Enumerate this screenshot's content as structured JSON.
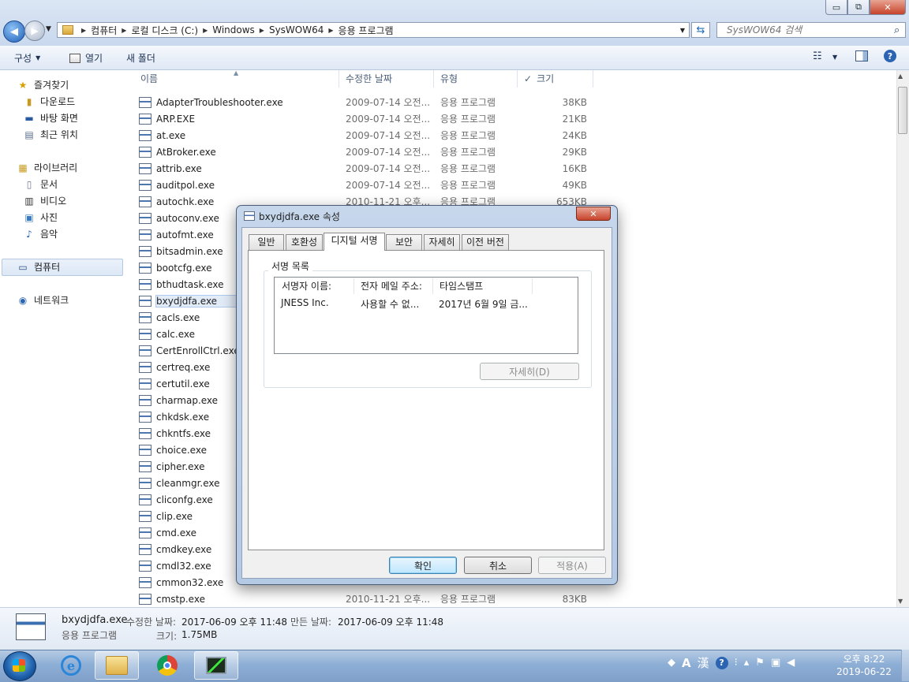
{
  "window": {
    "minimize": "▭",
    "maximize": "⧉",
    "close": "✕"
  },
  "address": {
    "crumbs": [
      "컴퓨터",
      "로컬 디스크 (C:)",
      "Windows",
      "SysWOW64",
      "응용 프로그램"
    ]
  },
  "search": {
    "placeholder": "SysWOW64 검색"
  },
  "toolbar": {
    "organize": "구성",
    "open": "열기",
    "new_folder": "새 폴더"
  },
  "navpane": {
    "favorites": "즐겨찾기",
    "downloads": "다운로드",
    "desktop": "바탕 화면",
    "recent": "최근 위치",
    "libraries": "라이브러리",
    "documents": "문서",
    "videos": "비디오",
    "pictures": "사진",
    "music": "음악",
    "computer": "컴퓨터",
    "network": "네트워크"
  },
  "columns": {
    "name": "이름",
    "date": "수정한 날짜",
    "type": "유형",
    "size": "크기"
  },
  "files": [
    {
      "name": "AdapterTroubleshooter.exe",
      "date": "2009-07-14 오전...",
      "type": "응용 프로그램",
      "size": "38KB"
    },
    {
      "name": "ARP.EXE",
      "date": "2009-07-14 오전...",
      "type": "응용 프로그램",
      "size": "21KB"
    },
    {
      "name": "at.exe",
      "date": "2009-07-14 오전...",
      "type": "응용 프로그램",
      "size": "24KB"
    },
    {
      "name": "AtBroker.exe",
      "date": "2009-07-14 오전...",
      "type": "응용 프로그램",
      "size": "29KB"
    },
    {
      "name": "attrib.exe",
      "date": "2009-07-14 오전...",
      "type": "응용 프로그램",
      "size": "16KB"
    },
    {
      "name": "auditpol.exe",
      "date": "2009-07-14 오전...",
      "type": "응용 프로그램",
      "size": "49KB"
    },
    {
      "name": "autochk.exe",
      "date": "2010-11-21 오후...",
      "type": "응용 프로그램",
      "size": "653KB"
    },
    {
      "name": "autoconv.exe",
      "date": "",
      "type": "",
      "size": ""
    },
    {
      "name": "autofmt.exe",
      "date": "",
      "type": "",
      "size": ""
    },
    {
      "name": "bitsadmin.exe",
      "date": "",
      "type": "",
      "size": ""
    },
    {
      "name": "bootcfg.exe",
      "date": "",
      "type": "",
      "size": ""
    },
    {
      "name": "bthudtask.exe",
      "date": "",
      "type": "",
      "size": ""
    },
    {
      "name": "bxydjdfa.exe",
      "date": "",
      "type": "",
      "size": ""
    },
    {
      "name": "cacls.exe",
      "date": "",
      "type": "",
      "size": ""
    },
    {
      "name": "calc.exe",
      "date": "",
      "type": "",
      "size": ""
    },
    {
      "name": "CertEnrollCtrl.exe",
      "date": "",
      "type": "",
      "size": ""
    },
    {
      "name": "certreq.exe",
      "date": "",
      "type": "",
      "size": ""
    },
    {
      "name": "certutil.exe",
      "date": "",
      "type": "",
      "size": ""
    },
    {
      "name": "charmap.exe",
      "date": "",
      "type": "",
      "size": ""
    },
    {
      "name": "chkdsk.exe",
      "date": "",
      "type": "",
      "size": ""
    },
    {
      "name": "chkntfs.exe",
      "date": "",
      "type": "",
      "size": ""
    },
    {
      "name": "choice.exe",
      "date": "",
      "type": "",
      "size": ""
    },
    {
      "name": "cipher.exe",
      "date": "",
      "type": "",
      "size": ""
    },
    {
      "name": "cleanmgr.exe",
      "date": "",
      "type": "",
      "size": ""
    },
    {
      "name": "cliconfg.exe",
      "date": "",
      "type": "",
      "size": ""
    },
    {
      "name": "clip.exe",
      "date": "",
      "type": "",
      "size": ""
    },
    {
      "name": "cmd.exe",
      "date": "",
      "type": "",
      "size": ""
    },
    {
      "name": "cmdkey.exe",
      "date": "",
      "type": "",
      "size": ""
    },
    {
      "name": "cmdl32.exe",
      "date": "",
      "type": "",
      "size": ""
    },
    {
      "name": "cmmon32.exe",
      "date": "",
      "type": "",
      "size": ""
    },
    {
      "name": "cmstp.exe",
      "date": "2010-11-21 오후...",
      "type": "응용 프로그램",
      "size": "83KB"
    }
  ],
  "details": {
    "filename": "bxydjdfa.exe",
    "filetype": "응용 프로그램",
    "modified_label": "수정한 날짜:",
    "modified": "2017-06-09 오후 11:48",
    "created_label": "만든 날짜:",
    "created": "2017-06-09 오후 11:48",
    "size_label": "크기:",
    "size": "1.75MB"
  },
  "dialog": {
    "title": "bxydjdfa.exe 속성",
    "tabs": [
      "일반",
      "호환성",
      "디지털 서명",
      "보안",
      "자세히",
      "이전 버전"
    ],
    "group_label": "서명 목록",
    "list_headers": [
      "서명자 이름:",
      "전자 메일 주소:",
      "타임스탬프"
    ],
    "signature": {
      "name": "JNESS Inc.",
      "email": "사용할 수 없...",
      "timestamp": "2017년 6월 9일 금..."
    },
    "details_button": "자세히(D)",
    "ok": "확인",
    "cancel": "취소",
    "apply": "적용(A)"
  },
  "taskbar": {
    "ime_a": "A",
    "ime_han": "漢",
    "time": "오후 8:22",
    "date": "2019-06-22"
  }
}
